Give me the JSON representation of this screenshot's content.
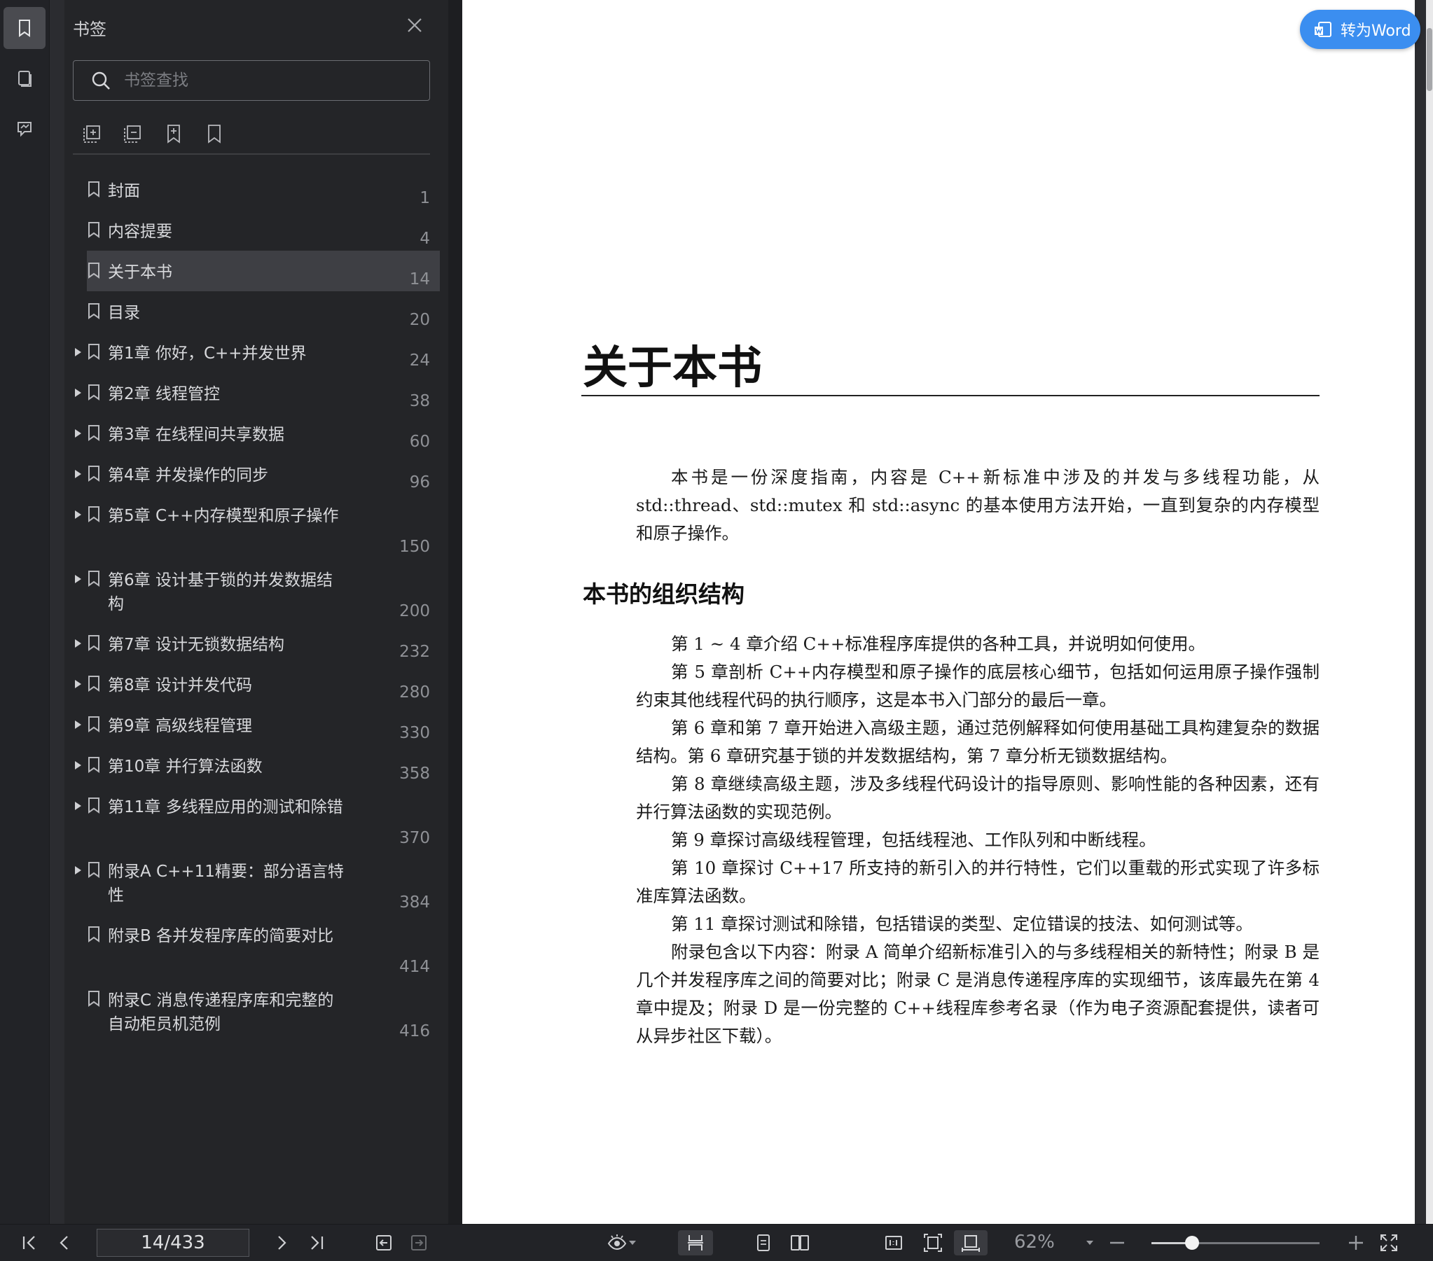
{
  "rail": {
    "items": [
      {
        "icon": "bookmark-icon",
        "active": true
      },
      {
        "icon": "pages-icon",
        "active": false
      },
      {
        "icon": "annotation-icon",
        "active": false
      }
    ]
  },
  "panel": {
    "title": "书签",
    "search_placeholder": "书签查找",
    "tools": [
      "expand-all-icon",
      "collapse-all-icon",
      "add-bookmark-icon",
      "bookmark-outline-icon"
    ],
    "items": [
      {
        "label": "封面",
        "page": "1",
        "expandable": false,
        "active": false
      },
      {
        "label": "内容提要",
        "page": "4",
        "expandable": false,
        "active": false
      },
      {
        "label": "关于本书",
        "page": "14",
        "expandable": false,
        "active": true
      },
      {
        "label": "目录",
        "page": "20",
        "expandable": false,
        "active": false
      },
      {
        "label": "第1章 你好，C++并发世界",
        "page": "24",
        "expandable": true,
        "active": false
      },
      {
        "label": "第2章 线程管控",
        "page": "38",
        "expandable": true,
        "active": false
      },
      {
        "label": "第3章 在线程间共享数据",
        "page": "60",
        "expandable": true,
        "active": false
      },
      {
        "label": "第4章 并发操作的同步",
        "page": "96",
        "expandable": true,
        "active": false
      },
      {
        "label": "第5章 C++内存模型和原子操作",
        "page": "150",
        "expandable": true,
        "active": false
      },
      {
        "label": "第6章 设计基于锁的并发数据结构",
        "page": "200",
        "expandable": true,
        "active": false
      },
      {
        "label": "第7章 设计无锁数据结构",
        "page": "232",
        "expandable": true,
        "active": false
      },
      {
        "label": "第8章 设计并发代码",
        "page": "280",
        "expandable": true,
        "active": false
      },
      {
        "label": "第9章 高级线程管理",
        "page": "330",
        "expandable": true,
        "active": false
      },
      {
        "label": "第10章 并行算法函数",
        "page": "358",
        "expandable": true,
        "active": false
      },
      {
        "label": "第11章 多线程应用的测试和除错",
        "page": "370",
        "expandable": true,
        "active": false
      },
      {
        "label": "附录A C++11精要：部分语言特性",
        "page": "384",
        "expandable": true,
        "active": false
      },
      {
        "label": "附录B 各并发程序库的简要对比",
        "page": "414",
        "expandable": false,
        "active": false
      },
      {
        "label": "附录C 消息传递程序库和完整的自动柜员机范例",
        "page": "416",
        "expandable": false,
        "active": false
      }
    ]
  },
  "convert_button": {
    "label": "转为Word",
    "color": "#3b8ef0"
  },
  "document": {
    "title": "关于本书",
    "intro": "本书是一份深度指南，内容是 C++新标准中涉及的并发与多线程功能，从 std::thread、std::mutex 和 std::async 的基本使用方法开始，一直到复杂的内存模型和原子操作。",
    "section_title": "本书的组织结构",
    "paragraphs": [
      "第 1 ~ 4 章介绍 C++标准程序库提供的各种工具，并说明如何使用。",
      "第 5 章剖析 C++内存模型和原子操作的底层核心细节，包括如何运用原子操作强制约束其他线程代码的执行顺序，这是本书入门部分的最后一章。",
      "第 6 章和第 7 章开始进入高级主题，通过范例解释如何使用基础工具构建复杂的数据结构。第 6 章研究基于锁的并发数据结构，第 7 章分析无锁数据结构。",
      "第 8 章继续高级主题，涉及多线程代码设计的指导原则、影响性能的各种因素，还有并行算法函数的实现范例。",
      "第 9 章探讨高级线程管理，包括线程池、工作队列和中断线程。",
      "第 10 章探讨 C++17 所支持的新引入的并行特性，它们以重载的形式实现了许多标准库算法函数。",
      "第 11 章探讨测试和除错，包括错误的类型、定位错误的技法、如何测试等。",
      "附录包含以下内容：附录 A 简单介绍新标准引入的与多线程相关的新特性；附录 B 是几个并发程序库之间的简要对比；附录 C 是消息传递程序库的实现细节，该库最先在第 4 章中提及；附录 D 是一份完整的 C++线程库参考名录（作为电子资源配套提供，读者可从异步社区下载）。"
    ]
  },
  "bottombar": {
    "page_indicator": "14/433",
    "zoom": "62%",
    "zoom_level": 0.24
  }
}
